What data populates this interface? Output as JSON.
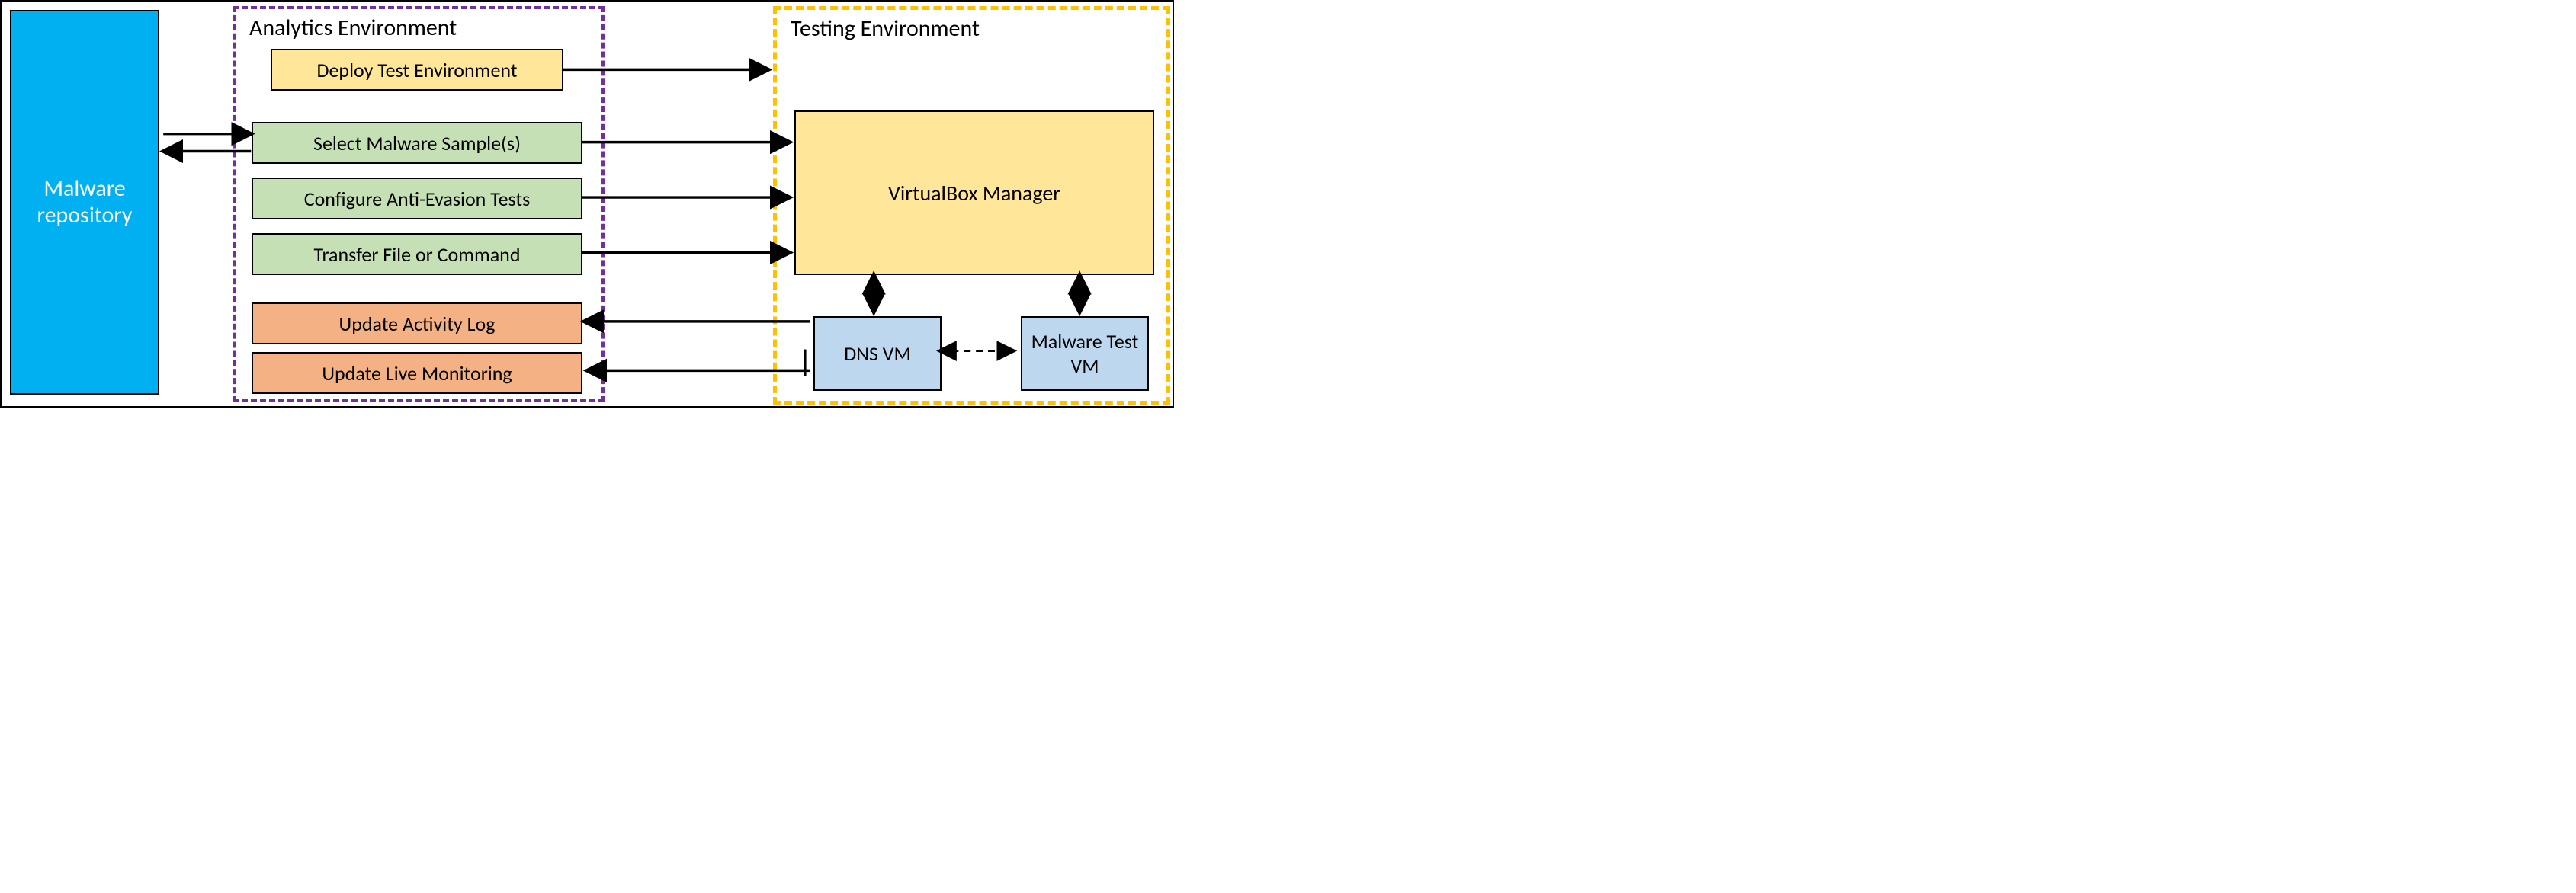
{
  "malware_repo": {
    "label": "Malware repository"
  },
  "analytics": {
    "title": "Analytics Environment",
    "steps": {
      "deploy": "Deploy Test Environment",
      "select": "Select Malware Sample(s)",
      "config": "Configure Anti-Evasion Tests",
      "transfer": "Transfer File or Command",
      "log": "Update Activity Log",
      "monitor": "Update Live Monitoring"
    }
  },
  "testing": {
    "title": "Testing Environment",
    "vb_manager": "VirtualBox Manager",
    "dns_vm": "DNS VM",
    "malware_vm": "Malware Test VM"
  }
}
